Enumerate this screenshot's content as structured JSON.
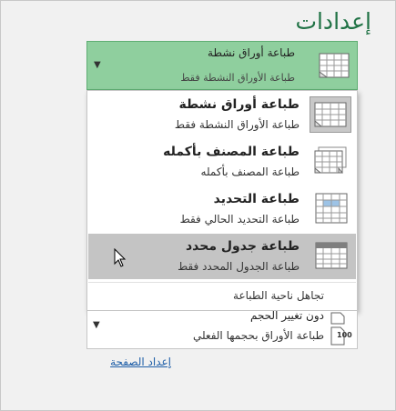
{
  "header": {
    "title": "إعدادات"
  },
  "current_selection": {
    "title": "طباعة أوراق نشطة",
    "subtitle": "طباعة الأوراق النشطة فقط"
  },
  "print_what_options": [
    {
      "title": "طباعة أوراق نشطة",
      "subtitle": "طباعة الأوراق النشطة فقط",
      "icon": "active-sheets-icon",
      "selected": true,
      "hovered": false
    },
    {
      "title": "طباعة المصنف بأكمله",
      "subtitle": "طباعة المصنف بأكمله",
      "icon": "entire-workbook-icon",
      "selected": false,
      "hovered": false
    },
    {
      "title": "طباعة التحديد",
      "subtitle": "طباعة التحديد الحالي فقط",
      "icon": "selection-icon",
      "selected": false,
      "hovered": false
    },
    {
      "title": "طباعة جدول محدد",
      "subtitle": "طباعة الجدول المحدد فقط",
      "icon": "table-icon",
      "selected": false,
      "hovered": true
    }
  ],
  "ignore_print_area": "تجاهل ناحية الطباعة",
  "scaling": {
    "title": "دون تغيير الحجم",
    "subtitle": "طباعة الأوراق بحجمها الفعلي",
    "icon_label": "100"
  },
  "page_setup_link": "إعداد الصفحة",
  "colors": {
    "accent": "#217346",
    "selected_bg": "#8fcf9e",
    "hover_bg": "#c4c4c4",
    "link": "#1f5fa8"
  }
}
